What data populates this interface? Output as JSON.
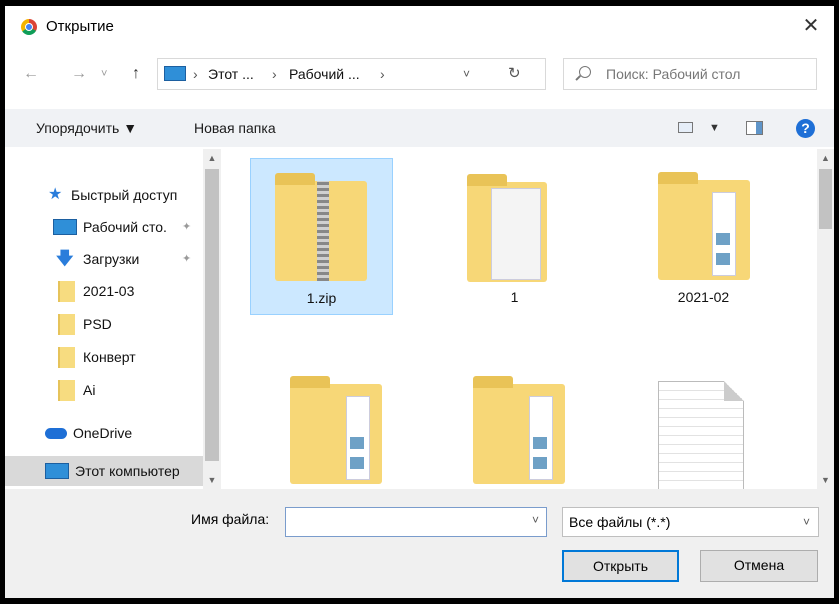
{
  "window": {
    "title": "Открытие",
    "close_glyph": "✕"
  },
  "nav": {
    "back": "←",
    "forward": "→",
    "dropdown": "˅",
    "up": "↑"
  },
  "address": {
    "crumbs": [
      "›",
      "Этот ...",
      "›",
      "Рабочий ...",
      "›"
    ],
    "dropdown": "˅",
    "refresh": "↻"
  },
  "search": {
    "placeholder": "Поиск: Рабочий стол"
  },
  "toolbar": {
    "organize": "Упорядочить ▼",
    "new_folder": "Новая папка",
    "view_dropdown": "▼",
    "help": "?"
  },
  "sidebar": {
    "items": [
      {
        "label": "Быстрый доступ",
        "icon": "star-icon"
      },
      {
        "label": "Рабочий сто.",
        "icon": "desktop-icon",
        "pinned": true
      },
      {
        "label": "Загрузки",
        "icon": "download-icon",
        "pinned": true
      },
      {
        "label": "2021-03",
        "icon": "folder-icon"
      },
      {
        "label": "PSD",
        "icon": "folder-icon"
      },
      {
        "label": "Конверт",
        "icon": "folder-icon"
      },
      {
        "label": "Ai",
        "icon": "folder-icon"
      },
      {
        "label": "OneDrive",
        "icon": "cloud-icon"
      },
      {
        "label": "Этот компьютер",
        "icon": "computer-icon",
        "selected": true
      }
    ],
    "pin_glyph": "📌"
  },
  "files": [
    {
      "name": "1.zip",
      "type": "zip-folder",
      "selected": true
    },
    {
      "name": "1",
      "type": "folder-docs"
    },
    {
      "name": "2021-02",
      "type": "folder-docs"
    },
    {
      "name": "",
      "type": "folder-docs"
    },
    {
      "name": "",
      "type": "folder-docs"
    },
    {
      "name": "",
      "type": "text-document"
    }
  ],
  "footer": {
    "filename_label": "Имя файла:",
    "filename_value": "",
    "filetype": "Все файлы (*.*)",
    "open": "Открыть",
    "cancel": "Отмена"
  },
  "scroll": {
    "up": "▲",
    "down": "▼"
  },
  "colors": {
    "accent": "#0078d7",
    "selection": "#cce8ff",
    "folder": "#f7d777"
  }
}
